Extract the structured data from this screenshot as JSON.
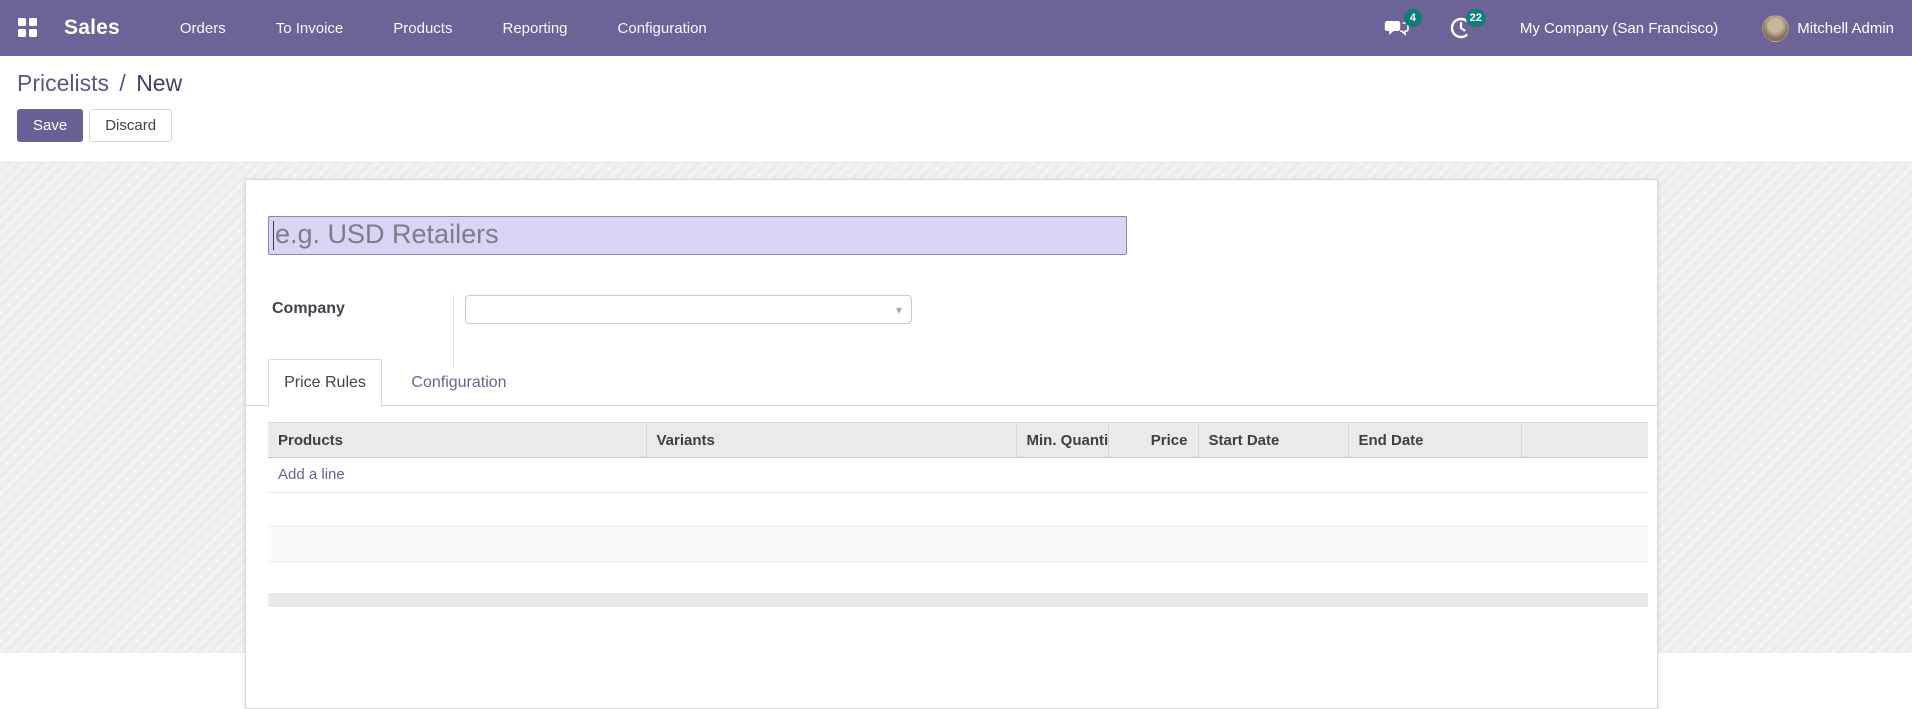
{
  "navbar": {
    "brand": "Sales",
    "menu": [
      "Orders",
      "To Invoice",
      "Products",
      "Reporting",
      "Configuration"
    ],
    "messages_badge": "4",
    "activities_badge": "22",
    "company": "My Company (San Francisco)",
    "user": "Mitchell Admin"
  },
  "breadcrumb": {
    "parent": "Pricelists",
    "separator": "/",
    "current": "New"
  },
  "actions": {
    "save": "Save",
    "discard": "Discard"
  },
  "form": {
    "name_placeholder": "e.g. USD Retailers",
    "name_value": "",
    "company_label": "Company",
    "company_value": "",
    "tabs": [
      "Price Rules",
      "Configuration"
    ],
    "active_tab": "Price Rules",
    "table": {
      "headers": [
        "Products",
        "Variants",
        "Min. Quanti...",
        "Price",
        "Start Date",
        "End Date",
        ""
      ],
      "add_line": "Add a line",
      "rows": []
    }
  },
  "colors": {
    "navbar_bg": "#6e6396",
    "badge_teal": "#107d7b",
    "primary_button": "#6b6096",
    "link_purple": "#6a6295",
    "input_highlight": "#d7d4f4",
    "input_border": "#8a85bd"
  }
}
